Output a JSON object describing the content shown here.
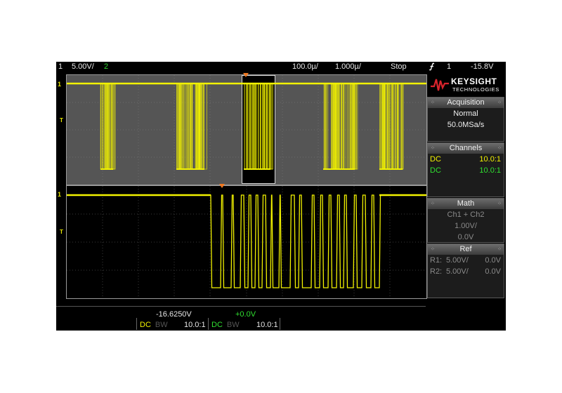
{
  "topbar": {
    "ch1_number": "1",
    "ch1_scale": "5.00V/",
    "ch2_number": "2",
    "horiz_scale": "100.0µ/",
    "horiz_delay": "1.000µ/",
    "run_state": "Stop",
    "trigger_icon": "trigger-edge-icon",
    "trigger_source": "1",
    "trigger_level": "-15.8V"
  },
  "markers": {
    "ch1_marker": "1",
    "trigger_level_marker": "T"
  },
  "brand": {
    "name": "KEYSIGHT",
    "sub": "TECHNOLOGIES",
    "color": "#d8242c"
  },
  "acquisition": {
    "title": "Acquisition",
    "mode": "Normal",
    "sample_rate": "50.0MSa/s"
  },
  "channels": {
    "title": "Channels",
    "rows": [
      {
        "coupling": "DC",
        "probe": "10.0:1",
        "color": "#f2f200"
      },
      {
        "coupling": "DC",
        "probe": "10.0:1",
        "color": "#30e030"
      }
    ]
  },
  "math": {
    "title": "Math",
    "function": "Ch1 + Ch2",
    "scale": "1.00V/",
    "offset": "0.0V"
  },
  "ref": {
    "title": "Ref",
    "rows": [
      {
        "name": "R1:",
        "scale": "5.00V/",
        "offset": "0.0V"
      },
      {
        "name": "R2:",
        "scale": "5.00V/",
        "offset": "0.0V"
      }
    ]
  },
  "bottom": {
    "ch1_offset": "-16.6250V",
    "ch1_coupling": "DC",
    "ch1_bw": "BW",
    "ch1_probe": "10.0:1",
    "ch2_offset": "+0.0V",
    "ch2_coupling": "DC",
    "ch2_bw": "BW",
    "ch2_probe": "10.0:1"
  },
  "colors": {
    "ch1": "#f2f200",
    "ch2": "#30e030",
    "trigger": "#f07820",
    "zoom_bg": "#555555",
    "screen_bg": "#000000"
  }
}
